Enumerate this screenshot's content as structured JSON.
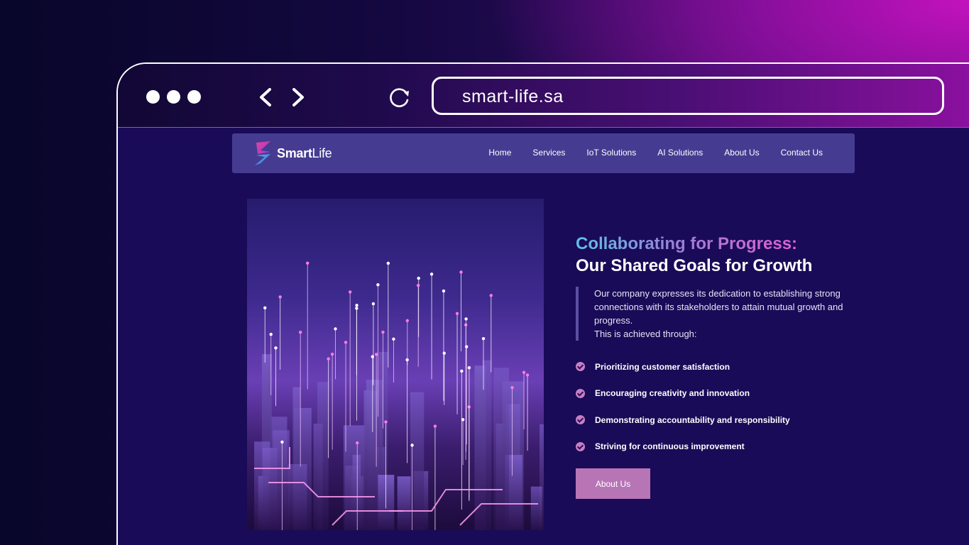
{
  "browser": {
    "url": "smart-life.sa",
    "window_dots": 3
  },
  "site": {
    "logo": {
      "bold": "Smart",
      "thin": "Life"
    },
    "menu": [
      "Home",
      "Services",
      "IoT Solutions",
      "AI Solutions",
      "About Us",
      "Contact Us"
    ]
  },
  "hero": {
    "heading_line1": "Collaborating for Progress:",
    "heading_line2": "Our Shared Goals for Growth",
    "paragraph": "Our company expresses its dedication to establishing strong connections with its stakeholders to attain mutual growth and progress.",
    "paragraph_tail": "This is achieved through:",
    "goals": [
      "Prioritizing customer satisfaction",
      "Encouraging creativity and innovation",
      "Demonstrating accountability and responsibility",
      "Striving for continuous improvement"
    ],
    "cta_label": "About Us"
  },
  "colors": {
    "accent": "#b875b6",
    "nav_bg": "#453c92",
    "page_bg": "#190b57"
  }
}
